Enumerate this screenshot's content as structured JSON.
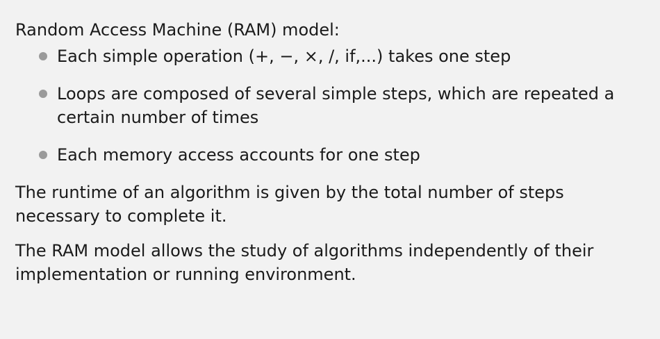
{
  "intro": "Random Access Machine (RAM) model:",
  "bullets": [
    "Each simple operation (+, −, ×, /, if,...) takes one step",
    "Loops are composed of several simple steps, which are repeated a certain number of times",
    "Each memory access accounts for one step"
  ],
  "paragraphs": [
    "The runtime of an algorithm is given by the total number of steps necessary to complete it.",
    "The RAM model allows the study of algorithms independently of their implementation or running environment."
  ]
}
